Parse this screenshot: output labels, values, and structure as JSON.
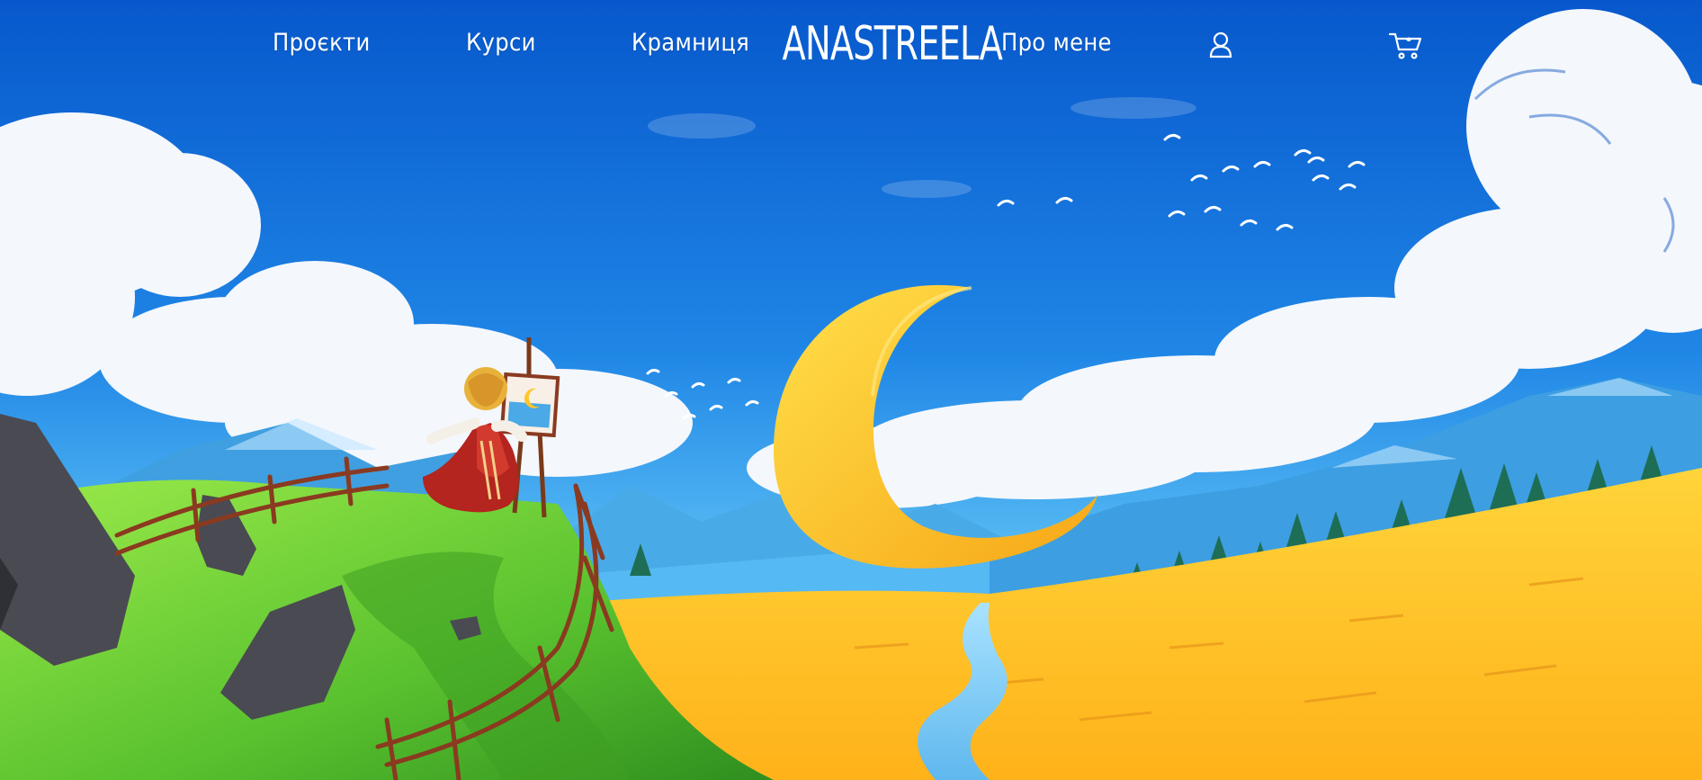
{
  "nav": {
    "items": [
      {
        "label": "Проєкти",
        "name": "nav-projects"
      },
      {
        "label": "Курси",
        "name": "nav-courses"
      },
      {
        "label": "Крамниця",
        "name": "nav-shop"
      },
      {
        "label": "Про мене",
        "name": "nav-about"
      }
    ],
    "logo_text": "ANASTREELA",
    "account_icon": "user-icon",
    "cart_icon": "cart-icon"
  },
  "colors": {
    "sky_top": "#0a5fd0",
    "sky_bottom": "#49b6f2",
    "cloud": "#f4f7fc",
    "moon": "#ffc629",
    "field": "#ffbf1f",
    "hill": "#7bd13a",
    "mountains": "#4aa9e6",
    "dress": "#b3251e",
    "text": "#ffffff"
  }
}
